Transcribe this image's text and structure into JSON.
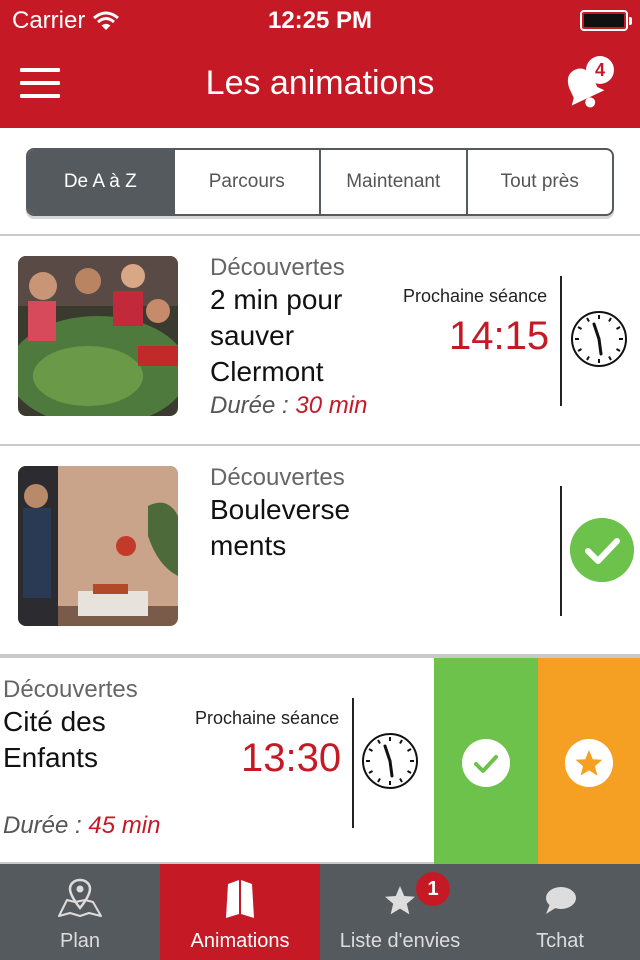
{
  "status_bar": {
    "carrier": "Carrier",
    "time": "12:25 PM"
  },
  "nav": {
    "title": "Les animations",
    "notification_count": "4"
  },
  "segments": [
    {
      "label": "De A à Z",
      "active": true
    },
    {
      "label": "Parcours",
      "active": false
    },
    {
      "label": "Maintenant",
      "active": false
    },
    {
      "label": "Tout près",
      "active": false
    }
  ],
  "items": [
    {
      "category": "Découvertes",
      "name_lines": [
        "2 min pour",
        "sauver",
        "Clermont"
      ],
      "duration_label": "Durée : ",
      "duration_value": "30 min",
      "next_label": "Prochaine séance",
      "next_time": "14:15",
      "state_icon": "clock-icon"
    },
    {
      "category": "Découvertes",
      "name_lines": [
        "Bouleverse",
        "ments"
      ],
      "state_icon": "check-icon"
    },
    {
      "category": "Découvertes",
      "name_lines": [
        "Cité des",
        "Enfants"
      ],
      "duration_label": "Durée : ",
      "duration_value": "45 min",
      "next_label": "Prochaine séance",
      "next_time": "13:30",
      "state_icon": "clock-icon",
      "swipe_actions": [
        "check-icon",
        "star-icon"
      ]
    }
  ],
  "tabbar": [
    {
      "label": "Plan",
      "icon": "map-pin-icon",
      "active": false
    },
    {
      "label": "Animations",
      "icon": "book-icon",
      "active": true
    },
    {
      "label": "Liste d'envies",
      "icon": "star-icon",
      "active": false,
      "badge": "1"
    },
    {
      "label": "Tchat",
      "icon": "chat-bubble-icon",
      "active": false
    }
  ],
  "colors": {
    "brand_red": "#c51a26",
    "dark_gray": "#555a5e",
    "green": "#6cc24a",
    "orange": "#f5a023"
  }
}
